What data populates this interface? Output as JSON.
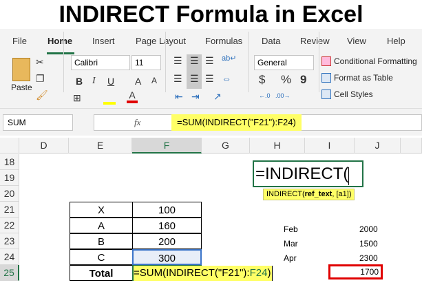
{
  "title": "INDIRECT Formula in Excel",
  "tabs": [
    "File",
    "Home",
    "Insert",
    "Page Layout",
    "Formulas",
    "Data",
    "Review",
    "View",
    "Help"
  ],
  "ribbon": {
    "paste": "Paste",
    "font": "Calibri",
    "size": "11",
    "number_format": "General",
    "bold": "B",
    "italic": "I",
    "underline": "U",
    "conditional": "Conditional Formatting",
    "format_table": "Format as Table",
    "cell_styles": "Cell Styles",
    "dollar": "$",
    "percent": "%",
    "comma": "9"
  },
  "formula_bar": {
    "name_box": "SUM",
    "fx": "fx",
    "formula": "=SUM(INDIRECT(\"F21\"):F24)"
  },
  "columns": [
    "D",
    "E",
    "F",
    "G",
    "H",
    "I",
    "J"
  ],
  "rows": [
    "18",
    "19",
    "20",
    "21",
    "22",
    "23",
    "24",
    "25"
  ],
  "table": [
    {
      "label": "X",
      "value": "100"
    },
    {
      "label": "A",
      "value": "160"
    },
    {
      "label": "B",
      "value": "200"
    },
    {
      "label": "C",
      "value": "300"
    }
  ],
  "total_label": "Total",
  "total_formula_a": "=SUM(INDIRECT(\"F21\"):",
  "total_formula_b": "F24",
  "total_formula_c": ")",
  "indirect_entry": "=INDIRECT(",
  "tooltip": {
    "pre": "INDIRECT(",
    "arg": "ref_text",
    "post": ", [a1])"
  },
  "side": [
    {
      "month": "Feb",
      "value": "2000"
    },
    {
      "month": "Mar",
      "value": "1500"
    },
    {
      "month": "Apr",
      "value": "2300"
    }
  ],
  "side_result": "1700"
}
